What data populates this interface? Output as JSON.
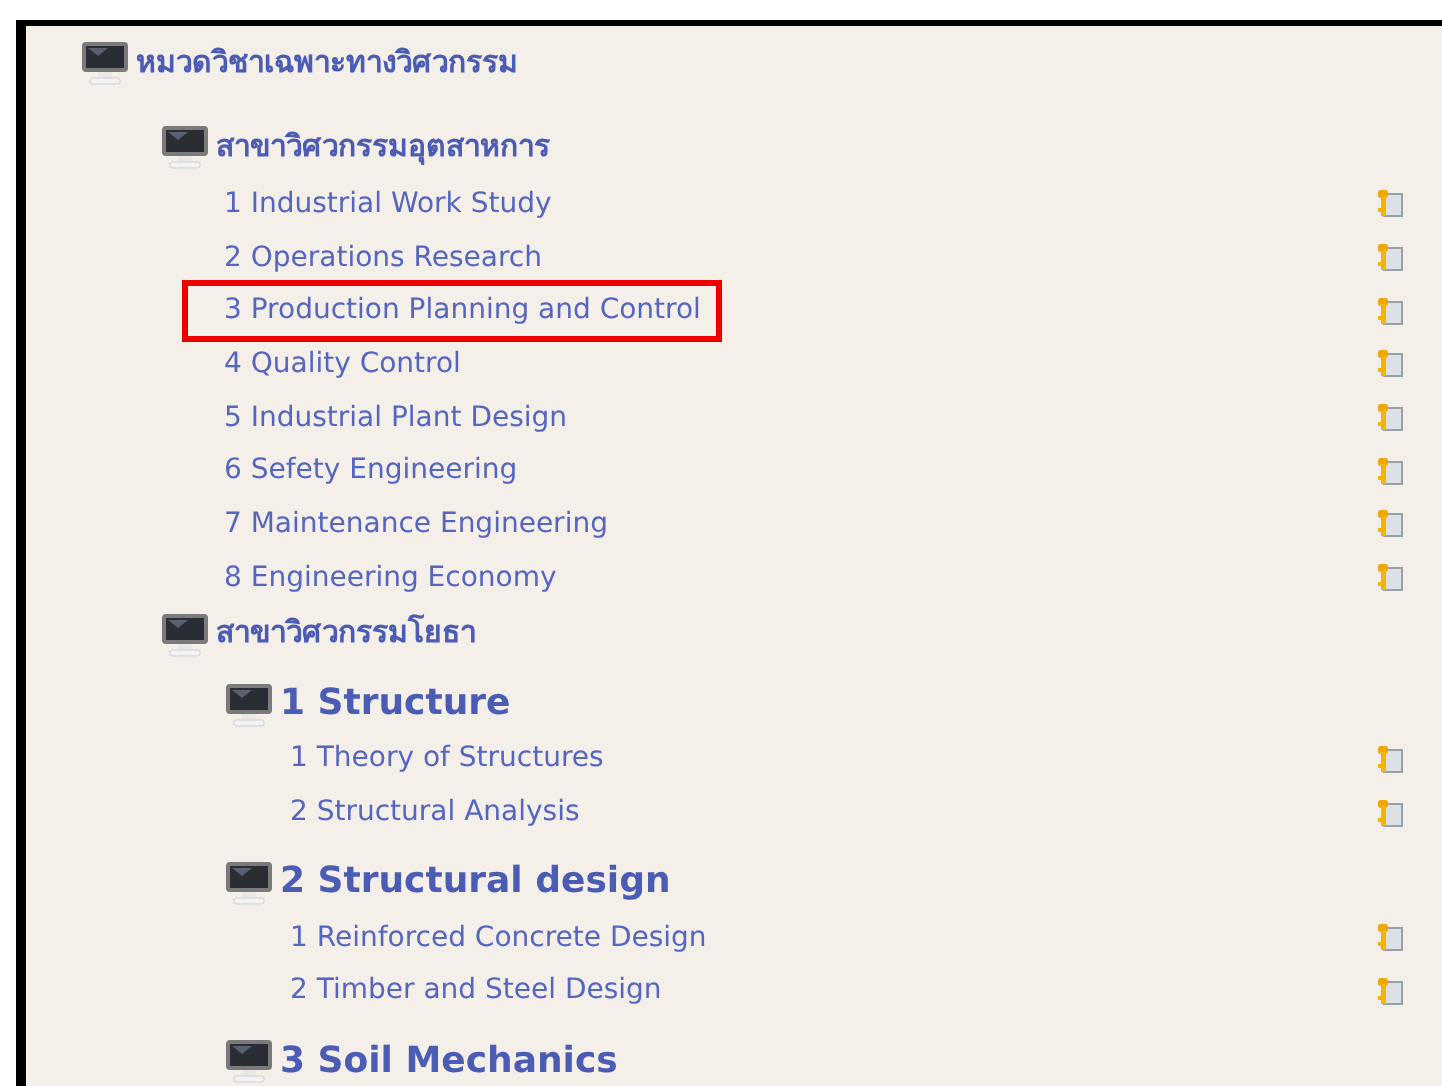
{
  "tree": [
    {
      "label": "หมวดวิชาเฉพาะทางวิศวกรรม",
      "kind": "category",
      "children": [
        {
          "label": "สาขาวิศวกรรมอุตสาหการ",
          "kind": "branch",
          "children": [
            {
              "label": "1 Industrial Work Study",
              "kind": "course",
              "highlighted": false
            },
            {
              "label": "2 Operations Research",
              "kind": "course",
              "highlighted": false
            },
            {
              "label": "3 Production Planning and Control",
              "kind": "course",
              "highlighted": true
            },
            {
              "label": "4 Quality Control",
              "kind": "course",
              "highlighted": false
            },
            {
              "label": "5 Industrial Plant Design",
              "kind": "course",
              "highlighted": false
            },
            {
              "label": "6 Sefety Engineering",
              "kind": "course",
              "highlighted": false
            },
            {
              "label": "7 Maintenance Engineering",
              "kind": "course",
              "highlighted": false
            },
            {
              "label": "8 Engineering Economy",
              "kind": "course",
              "highlighted": false
            }
          ]
        },
        {
          "label": "สาขาวิศวกรรมโยธา",
          "kind": "branch",
          "children": [
            {
              "label": "1 Structure",
              "kind": "subject",
              "children": [
                {
                  "label": "1 Theory of Structures",
                  "kind": "course",
                  "highlighted": false
                },
                {
                  "label": "2 Structural Analysis",
                  "kind": "course",
                  "highlighted": false
                }
              ]
            },
            {
              "label": "2 Structural design",
              "kind": "subject",
              "children": [
                {
                  "label": "1 Reinforced Concrete Design",
                  "kind": "course",
                  "highlighted": false
                },
                {
                  "label": "2 Timber and Steel Design",
                  "kind": "course",
                  "highlighted": false
                }
              ]
            },
            {
              "label": "3 Soil Mechanics",
              "kind": "subject"
            }
          ]
        }
      ]
    }
  ]
}
